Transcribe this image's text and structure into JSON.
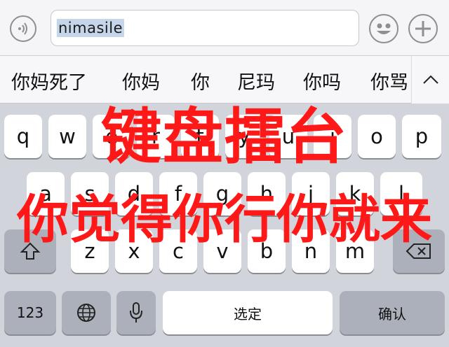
{
  "input_bar": {
    "text_value": "nimasile",
    "voice_icon": "voice-input-icon",
    "emoji_icon": "emoji-icon",
    "add_icon": "plus-icon"
  },
  "candidates": [
    "你妈死了",
    "你妈",
    "你",
    "尼玛",
    "你吗",
    "你骂"
  ],
  "expand_icon": "chevron-up-icon",
  "keyboard": {
    "row1": [
      "q",
      "w",
      "e",
      "r",
      "t",
      "y",
      "u",
      "i",
      "o",
      "p"
    ],
    "row2": [
      "a",
      "s",
      "d",
      "f",
      "g",
      "h",
      "j",
      "k",
      "l"
    ],
    "row3": [
      "z",
      "x",
      "c",
      "v",
      "b",
      "n",
      "m"
    ],
    "shift_icon": "shift-icon",
    "delete_icon": "backspace-icon",
    "numbers_label": "123",
    "globe_icon": "globe-icon",
    "mic_icon": "microphone-icon",
    "space_label": "选定",
    "confirm_label": "确认"
  },
  "overlay": {
    "line1": "键盘擂台",
    "line2": "你觉得你行你就来"
  },
  "colors": {
    "overlay_text": "#ff1818",
    "key_background": "#ffffff",
    "function_key_background": "#abb0ba",
    "keyboard_background": "#d1d4db"
  }
}
